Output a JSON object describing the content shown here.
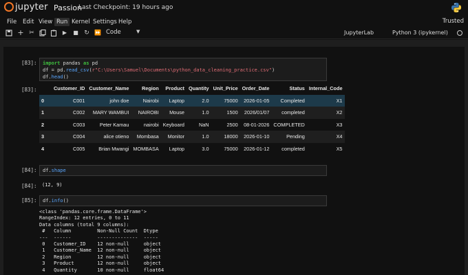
{
  "header": {
    "logo_text": "jupyter",
    "notebook_name": "Passion",
    "checkpoint": "Last Checkpoint: 19 hours ago"
  },
  "menu": {
    "items": [
      "File",
      "Edit",
      "View",
      "Run",
      "Kernel",
      "Settings",
      "Help"
    ],
    "active": "Run",
    "trusted": "Trusted"
  },
  "toolbar": {
    "cell_type": "Code",
    "jupyterlab": "JupyterLab",
    "kernel": "Python 3 (ipykernel)"
  },
  "cells": {
    "c83": {
      "in_prompt": "[83]:",
      "out_prompt": "[83]:",
      "code": {
        "l1_kw": "import",
        "l1_mid": " pandas ",
        "l1_kw2": "as",
        "l1_end": " pd",
        "l2_start": "df = pd.",
        "l2_fn": "read_csv",
        "l2_paren": "(",
        "l2_str": "r\"C:\\Users\\Samuel\\Documents\\python_data_cleaning_practice.csv\"",
        "l2_end": ")",
        "l3_start": "df.",
        "l3_fn": "head",
        "l3_end": "()"
      },
      "table": {
        "columns": [
          "Customer_ID",
          "Customer_Name",
          "Region",
          "Product",
          "Quantity",
          "Unit_Price",
          "Order_Date",
          "Status",
          "Internal_Code"
        ],
        "rows": [
          {
            "idx": "0",
            "cells": [
              "C001",
              "john doe",
              "Nairobi",
              "Laptop",
              "2.0",
              "75000",
              "2026-01-05",
              "Completed",
              "X1"
            ]
          },
          {
            "idx": "1",
            "cells": [
              "C002",
              "MARY WAMBUI",
              "NAIROBI",
              "Mouse",
              "1.0",
              "1500",
              "2026/01/07",
              "completed",
              "X2"
            ]
          },
          {
            "idx": "2",
            "cells": [
              "C003",
              "Peter Kamau",
              "nairobi",
              "Keyboard",
              "NaN",
              "2500",
              "08-01-2026",
              "COMPLETED",
              "X3"
            ]
          },
          {
            "idx": "3",
            "cells": [
              "C004",
              "alice otieno",
              "Mombasa",
              "Monitor",
              "1.0",
              "18000",
              "2026-01-10",
              "Pending",
              "X4"
            ]
          },
          {
            "idx": "4",
            "cells": [
              "C005",
              "Brian Mwangi",
              "MOMBASA",
              "Laptop",
              "3.0",
              "75000",
              "2026-01-12",
              "completed",
              "X5"
            ]
          }
        ]
      }
    },
    "c84": {
      "in_prompt": "[84]:",
      "out_prompt": "[84]:",
      "code_start": "df.",
      "code_attr": "shape",
      "output": "(12, 9)"
    },
    "c85": {
      "in_prompt": "[85]:",
      "code_start": "df.",
      "code_fn": "info",
      "code_end": "()",
      "output_lines": [
        "<class 'pandas.core.frame.DataFrame'>",
        "RangeIndex: 12 entries, 0 to 11",
        "Data columns (total 9 columns):",
        " #   Column         Non-Null Count  Dtype  ",
        "---  ------         --------------  -----  ",
        " 0   Customer_ID    12 non-null     object ",
        " 1   Customer_Name  12 non-null     object ",
        " 2   Region         12 non-null     object ",
        " 3   Product        12 non-null     object ",
        " 4   Quantity       10 non-null     float64"
      ]
    }
  }
}
